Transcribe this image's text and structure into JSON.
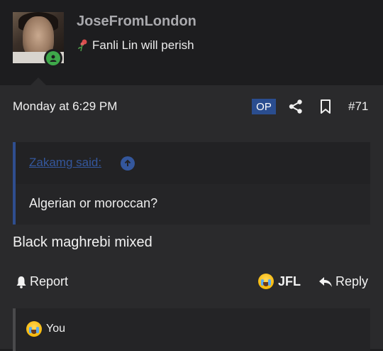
{
  "post": {
    "username": "JoseFromLondon",
    "user_title": "Fanli Lin will perish",
    "date": "Monday at 6:29 PM",
    "op_badge": "OP",
    "post_number": "#71",
    "quote": {
      "author": "Zakamg said:",
      "text": "Algerian or moroccan?"
    },
    "message": "Black maghrebi mixed",
    "actions": {
      "report": "Report",
      "reaction": "JFL",
      "reply": "Reply"
    },
    "reactions_summary": "You"
  },
  "colors": {
    "accent": "#2a4d8f",
    "online": "#3ea84a",
    "background": "#2a2a2c"
  },
  "icons": [
    "user-icon",
    "flower-icon",
    "share-icon",
    "bookmark-icon",
    "arrow-up-icon",
    "bell-icon",
    "crying-laughing-emoji-icon",
    "reply-icon"
  ]
}
